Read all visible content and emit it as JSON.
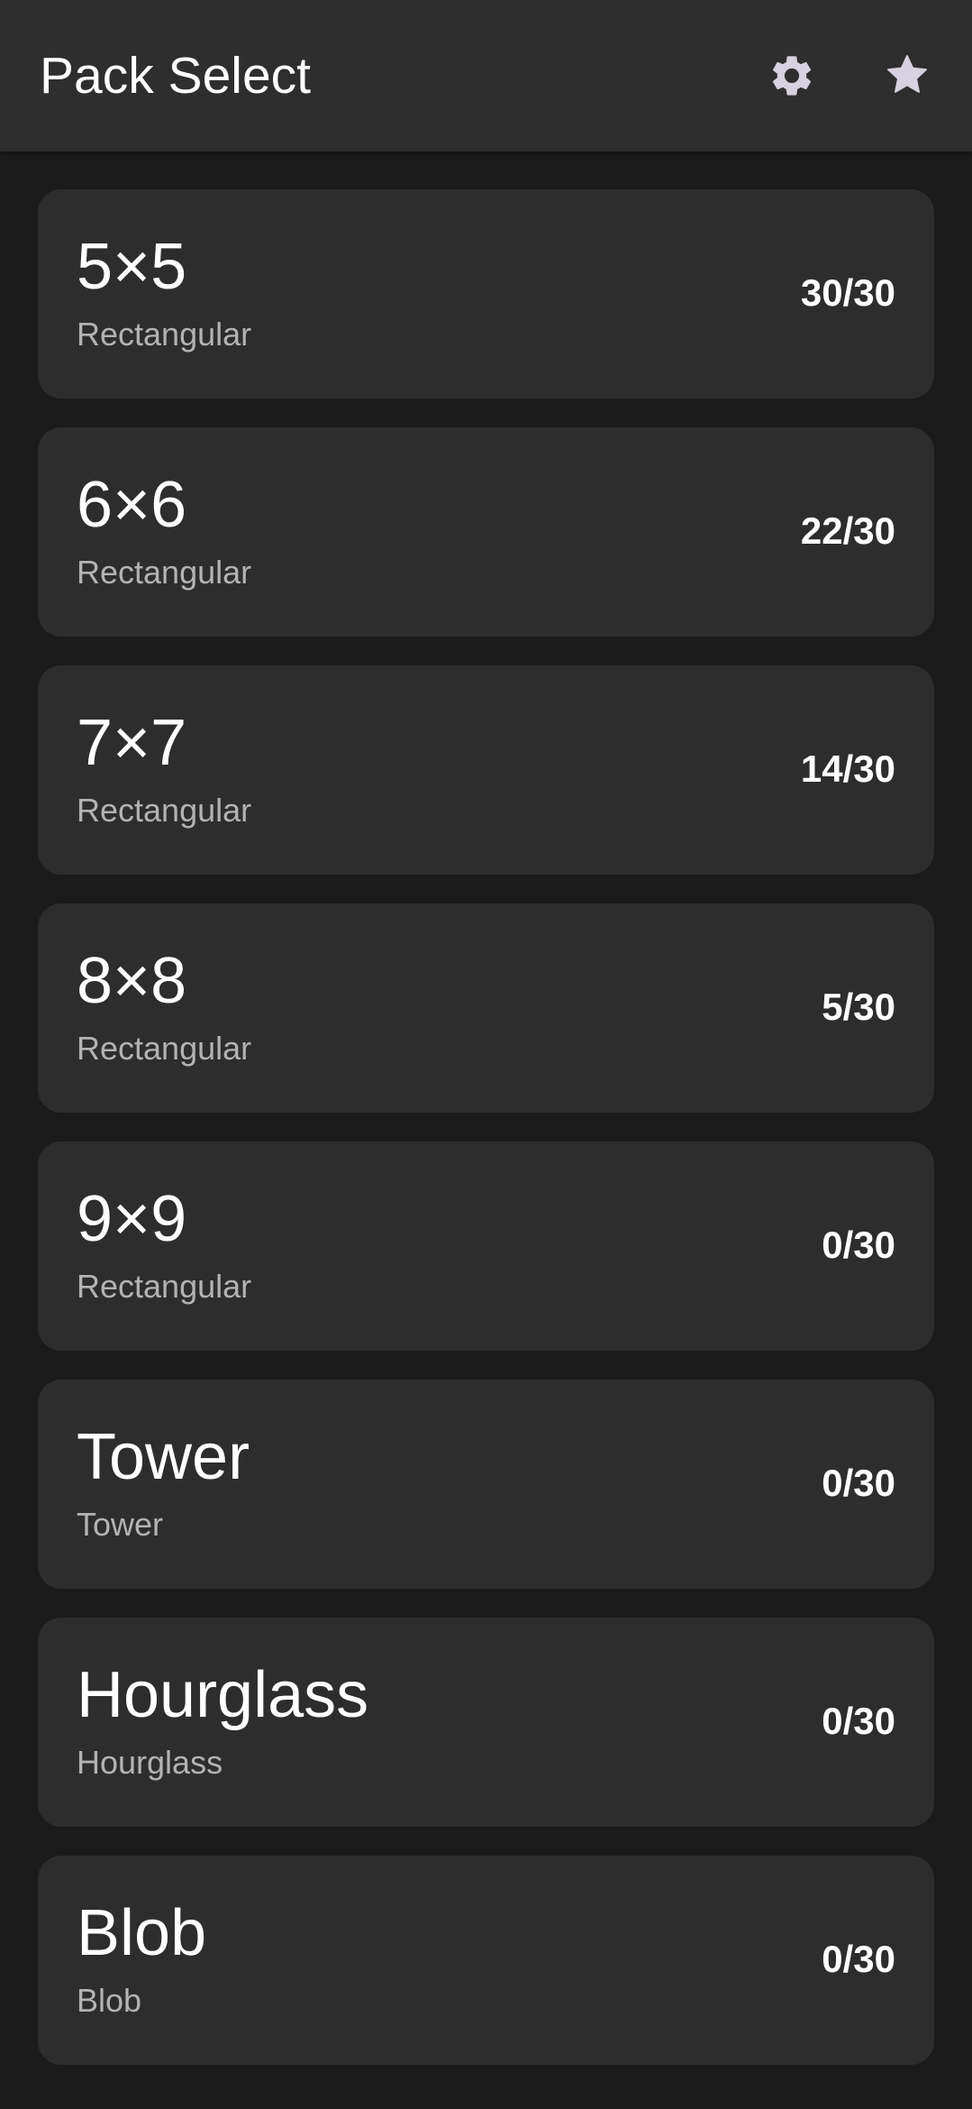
{
  "app_bar": {
    "title": "Pack Select",
    "actions": [
      {
        "icon": "gear-icon",
        "color": "#d8d1df"
      },
      {
        "icon": "star-icon",
        "color": "#d8d1df"
      }
    ]
  },
  "packs": [
    {
      "name": "5×5",
      "type": "Rectangular",
      "progress": "30/30"
    },
    {
      "name": "6×6",
      "type": "Rectangular",
      "progress": "22/30"
    },
    {
      "name": "7×7",
      "type": "Rectangular",
      "progress": "14/30"
    },
    {
      "name": "8×8",
      "type": "Rectangular",
      "progress": "5/30"
    },
    {
      "name": "9×9",
      "type": "Rectangular",
      "progress": "0/30"
    },
    {
      "name": "Tower",
      "type": "Tower",
      "progress": "0/30"
    },
    {
      "name": "Hourglass",
      "type": "Hourglass",
      "progress": "0/30"
    },
    {
      "name": "Blob",
      "type": "Blob",
      "progress": "0/30"
    }
  ],
  "colors": {
    "background": "#1b1b1b",
    "app_bar": "#2e2e2e",
    "card": "#2d2d2d",
    "primary_text": "#ffffff",
    "secondary_text": "#b3b3b3",
    "icon": "#d8d1df"
  }
}
